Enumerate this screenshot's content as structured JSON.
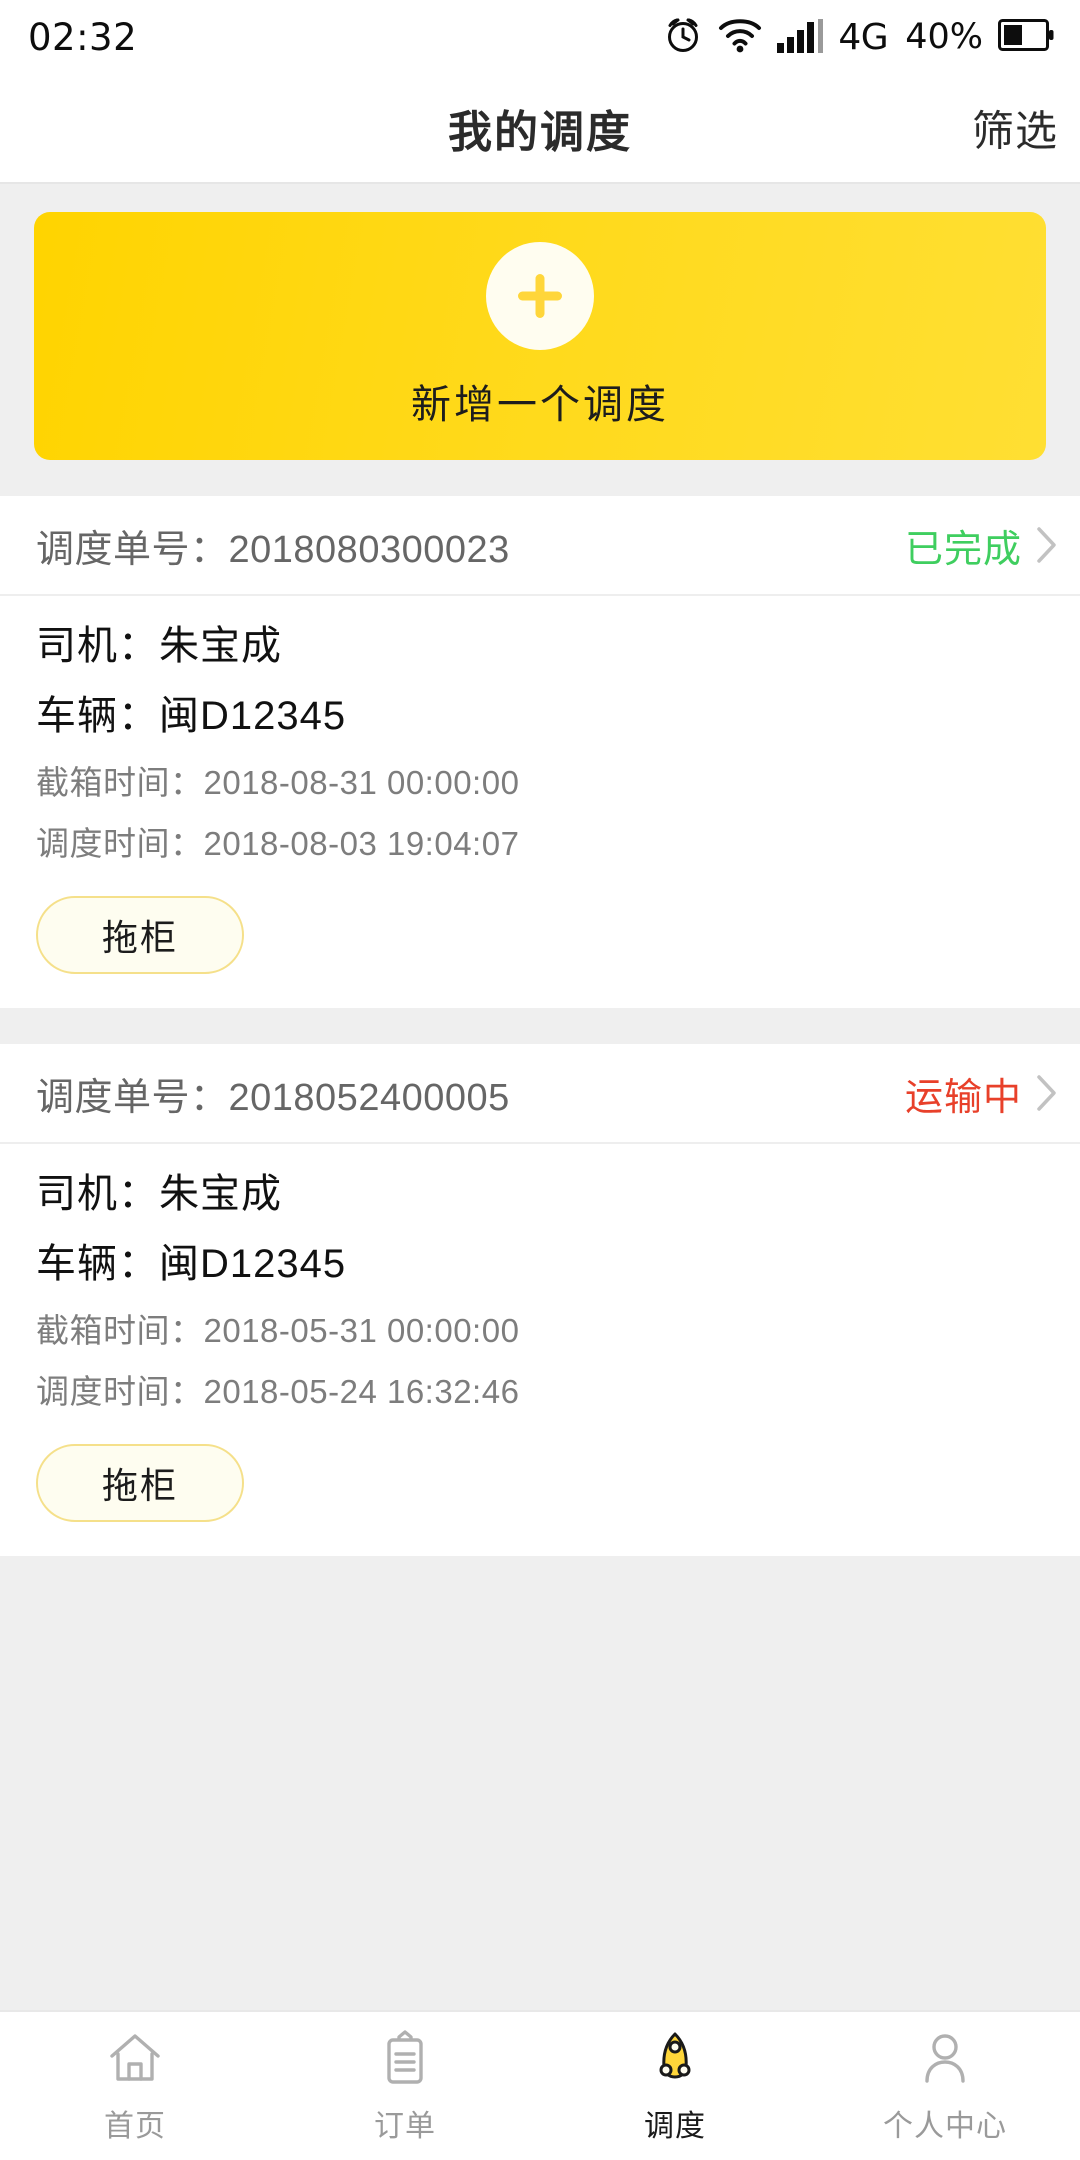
{
  "status_bar": {
    "time": "02:32",
    "network": "4G",
    "battery_percent": "40%",
    "icons": [
      "alarm-icon",
      "wifi-icon",
      "signal-icon",
      "battery-icon"
    ]
  },
  "nav": {
    "title": "我的调度",
    "right_action": "筛选"
  },
  "add_banner": {
    "label": "新增一个调度",
    "icon": "plus-icon",
    "color_start": "#ffd400",
    "color_end": "#ffdf33"
  },
  "labels": {
    "order_no": "调度单号：",
    "driver": "司机：",
    "vehicle": "车辆：",
    "cutoff_time": "截箱时间：",
    "dispatch_time": "调度时间："
  },
  "colors": {
    "status_done": "#3fce5f",
    "status_transit": "#e8402a",
    "accent": "#ffd400"
  },
  "cards": [
    {
      "order_no_label": "调度单号：",
      "order_no": "2018080300023",
      "status": "已完成",
      "status_type": "done",
      "driver_label": "司机：",
      "driver": "朱宝成",
      "vehicle_label": "车辆：",
      "vehicle": "闽D12345",
      "cutoff_label": "截箱时间：",
      "cutoff_time": "2018-08-31 00:00:00",
      "dispatch_label": "调度时间：",
      "dispatch_time": "2018-08-03 19:04:07",
      "tag": "拖柜"
    },
    {
      "order_no_label": "调度单号：",
      "order_no": "2018052400005",
      "status": "运输中",
      "status_type": "transit",
      "driver_label": "司机：",
      "driver": "朱宝成",
      "vehicle_label": "车辆：",
      "vehicle": "闽D12345",
      "cutoff_label": "截箱时间：",
      "cutoff_time": "2018-05-31 00:00:00",
      "dispatch_label": "调度时间：",
      "dispatch_time": "2018-05-24 16:32:46",
      "tag": "拖柜"
    }
  ],
  "tabbar": {
    "items": [
      {
        "label": "首页",
        "icon": "home-icon",
        "active": false
      },
      {
        "label": "订单",
        "icon": "clipboard-icon",
        "active": false
      },
      {
        "label": "调度",
        "icon": "rocket-icon",
        "active": true
      },
      {
        "label": "个人中心",
        "icon": "person-icon",
        "active": false
      }
    ]
  }
}
